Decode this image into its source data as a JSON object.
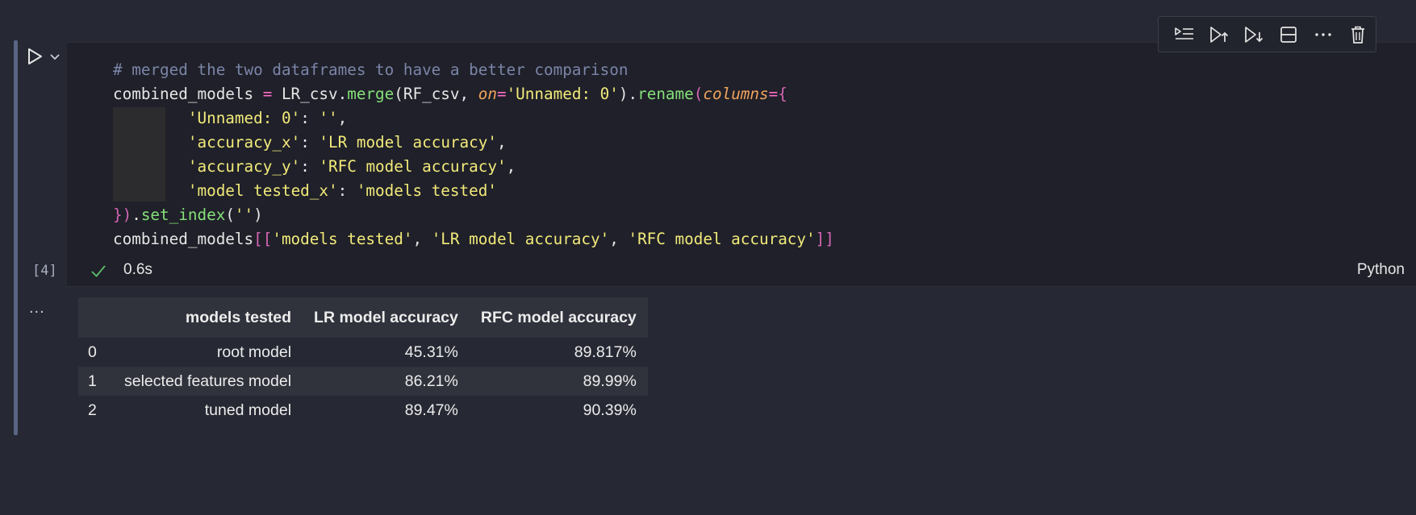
{
  "cell": {
    "code_lines": [
      [
        {
          "t": "# merged the two dataframes to have a better comparison",
          "c": "c-comment"
        }
      ],
      [
        {
          "t": "combined_models ",
          "c": ""
        },
        {
          "t": "=",
          "c": "c-op"
        },
        {
          "t": " LR_csv.",
          "c": ""
        },
        {
          "t": "merge",
          "c": "c-fn"
        },
        {
          "t": "(RF_csv, ",
          "c": ""
        },
        {
          "t": "on",
          "c": "c-param"
        },
        {
          "t": "=",
          "c": "c-op"
        },
        {
          "t": "'Unnamed: 0'",
          "c": "c-str"
        },
        {
          "t": ").",
          "c": ""
        },
        {
          "t": "rename",
          "c": "c-fn"
        },
        {
          "t": "(",
          "c": "c-br1"
        },
        {
          "t": "columns",
          "c": "c-param"
        },
        {
          "t": "=",
          "c": "c-op"
        },
        {
          "t": "{",
          "c": "c-br1"
        }
      ],
      [
        {
          "t": "        ",
          "c": ""
        },
        {
          "t": "'Unnamed: 0'",
          "c": "c-str"
        },
        {
          "t": ": ",
          "c": ""
        },
        {
          "t": "''",
          "c": "c-str"
        },
        {
          "t": ",",
          "c": ""
        }
      ],
      [
        {
          "t": "        ",
          "c": ""
        },
        {
          "t": "'accuracy_x'",
          "c": "c-str"
        },
        {
          "t": ": ",
          "c": ""
        },
        {
          "t": "'LR model accuracy'",
          "c": "c-str"
        },
        {
          "t": ",",
          "c": ""
        }
      ],
      [
        {
          "t": "        ",
          "c": ""
        },
        {
          "t": "'accuracy_y'",
          "c": "c-str"
        },
        {
          "t": ": ",
          "c": ""
        },
        {
          "t": "'RFC model accuracy'",
          "c": "c-str"
        },
        {
          "t": ",",
          "c": ""
        }
      ],
      [
        {
          "t": "        ",
          "c": ""
        },
        {
          "t": "'model tested_x'",
          "c": "c-str"
        },
        {
          "t": ": ",
          "c": ""
        },
        {
          "t": "'models tested'",
          "c": "c-str"
        }
      ],
      [
        {
          "t": "})",
          "c": "c-br1"
        },
        {
          "t": ".",
          "c": ""
        },
        {
          "t": "set_index",
          "c": "c-fn"
        },
        {
          "t": "(",
          "c": ""
        },
        {
          "t": "''",
          "c": "c-str"
        },
        {
          "t": ")",
          "c": ""
        }
      ],
      [
        {
          "t": "combined_models",
          "c": ""
        },
        {
          "t": "[[",
          "c": "c-br2"
        },
        {
          "t": "'models tested'",
          "c": "c-str"
        },
        {
          "t": ", ",
          "c": ""
        },
        {
          "t": "'LR model accuracy'",
          "c": "c-str"
        },
        {
          "t": ", ",
          "c": ""
        },
        {
          "t": "'RFC model accuracy'",
          "c": "c-str"
        },
        {
          "t": "]]",
          "c": "c-br2"
        }
      ]
    ],
    "execution_count": "[4]",
    "exec_time": "0.6s",
    "kernel": "Python",
    "output_more": "...",
    "colors": {
      "accent_bar": "#5a6585",
      "check": "#5fbf6a"
    }
  },
  "toolbar": {
    "buttons": [
      {
        "icon": "run-by-line-icon"
      },
      {
        "icon": "execute-above-icon"
      },
      {
        "icon": "execute-below-icon"
      },
      {
        "icon": "split-cell-icon"
      },
      {
        "icon": "more-actions-icon"
      },
      {
        "icon": "delete-cell-icon"
      }
    ]
  },
  "output": {
    "columns": [
      "",
      "models tested",
      "LR model accuracy",
      "RFC model accuracy"
    ],
    "rows": [
      [
        "0",
        "root model",
        "45.31%",
        "89.817%"
      ],
      [
        "1",
        "selected features model",
        "86.21%",
        "89.99%"
      ],
      [
        "2",
        "tuned model",
        "89.47%",
        "90.39%"
      ]
    ]
  }
}
